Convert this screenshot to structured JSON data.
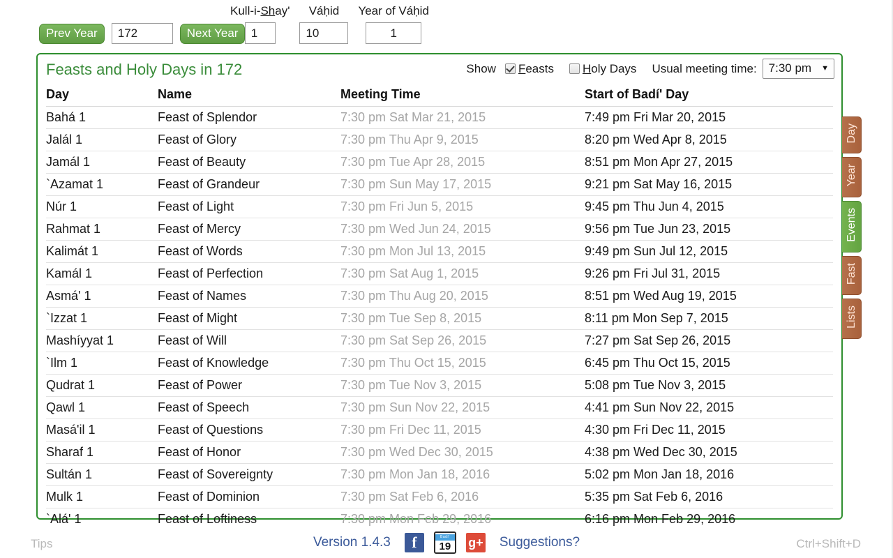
{
  "topbar": {
    "prev_year_label": "Prev Year",
    "next_year_label": "Next Year",
    "year_value": "172",
    "kullishay_label_prefix": "Kull-i-",
    "kullishay_label_underline": "Sh",
    "kullishay_label_suffix": "ay'",
    "kullishay_value": "1",
    "vahid_label": "Váḥid",
    "vahid_value": "10",
    "year_of_vahid_label": "Year of Váḥid",
    "year_of_vahid_value": "1"
  },
  "panel": {
    "title": "Feasts and Holy Days in 172",
    "show_label": "Show",
    "feasts_label_underline": "F",
    "feasts_label_rest": "easts",
    "feasts_checked": true,
    "holydays_label_underline": "H",
    "holydays_label_rest": "oly Days",
    "holydays_checked": false,
    "meeting_time_label": "Usual meeting time:",
    "meeting_time_value": "7:30 pm",
    "meeting_time_options": [
      "7:30 pm"
    ]
  },
  "table": {
    "columns": [
      "Day",
      "Name",
      "Meeting Time",
      "Start of Badí' Day"
    ],
    "rows": [
      {
        "day": "Bahá 1",
        "name": "Feast of Splendor",
        "meeting": "7:30 pm Sat Mar 21, 2015",
        "start": "7:49 pm Fri Mar 20, 2015"
      },
      {
        "day": "Jalál 1",
        "name": "Feast of Glory",
        "meeting": "7:30 pm Thu Apr 9, 2015",
        "start": "8:20 pm Wed Apr 8, 2015"
      },
      {
        "day": "Jamál 1",
        "name": "Feast of Beauty",
        "meeting": "7:30 pm Tue Apr 28, 2015",
        "start": "8:51 pm Mon Apr 27, 2015"
      },
      {
        "day": "`Azamat 1",
        "name": "Feast of Grandeur",
        "meeting": "7:30 pm Sun May 17, 2015",
        "start": "9:21 pm Sat May 16, 2015"
      },
      {
        "day": "Núr 1",
        "name": "Feast of Light",
        "meeting": "7:30 pm Fri Jun 5, 2015",
        "start": "9:45 pm Thu Jun 4, 2015"
      },
      {
        "day": "Rahmat 1",
        "name": "Feast of Mercy",
        "meeting": "7:30 pm Wed Jun 24, 2015",
        "start": "9:56 pm Tue Jun 23, 2015"
      },
      {
        "day": "Kalimát 1",
        "name": "Feast of Words",
        "meeting": "7:30 pm Mon Jul 13, 2015",
        "start": "9:49 pm Sun Jul 12, 2015"
      },
      {
        "day": "Kamál 1",
        "name": "Feast of Perfection",
        "meeting": "7:30 pm Sat Aug 1, 2015",
        "start": "9:26 pm Fri Jul 31, 2015"
      },
      {
        "day": "Asmá' 1",
        "name": "Feast of Names",
        "meeting": "7:30 pm Thu Aug 20, 2015",
        "start": "8:51 pm Wed Aug 19, 2015"
      },
      {
        "day": "`Izzat 1",
        "name": "Feast of Might",
        "meeting": "7:30 pm Tue Sep 8, 2015",
        "start": "8:11 pm Mon Sep 7, 2015"
      },
      {
        "day": "Mashíyyat 1",
        "name": "Feast of Will",
        "meeting": "7:30 pm Sat Sep 26, 2015",
        "start": "7:27 pm Sat Sep 26, 2015"
      },
      {
        "day": "`Ilm 1",
        "name": "Feast of Knowledge",
        "meeting": "7:30 pm Thu Oct 15, 2015",
        "start": "6:45 pm Thu Oct 15, 2015"
      },
      {
        "day": "Qudrat 1",
        "name": "Feast of Power",
        "meeting": "7:30 pm Tue Nov 3, 2015",
        "start": "5:08 pm Tue Nov 3, 2015"
      },
      {
        "day": "Qawl 1",
        "name": "Feast of Speech",
        "meeting": "7:30 pm Sun Nov 22, 2015",
        "start": "4:41 pm Sun Nov 22, 2015"
      },
      {
        "day": "Masá'il 1",
        "name": "Feast of Questions",
        "meeting": "7:30 pm Fri Dec 11, 2015",
        "start": "4:30 pm Fri Dec 11, 2015"
      },
      {
        "day": "Sharaf 1",
        "name": "Feast of Honor",
        "meeting": "7:30 pm Wed Dec 30, 2015",
        "start": "4:38 pm Wed Dec 30, 2015"
      },
      {
        "day": "Sultán 1",
        "name": "Feast of Sovereignty",
        "meeting": "7:30 pm Mon Jan 18, 2016",
        "start": "5:02 pm Mon Jan 18, 2016"
      },
      {
        "day": "Mulk 1",
        "name": "Feast of Dominion",
        "meeting": "7:30 pm Sat Feb 6, 2016",
        "start": "5:35 pm Sat Feb 6, 2016"
      },
      {
        "day": "`Alá' 1",
        "name": "Feast of Loftiness",
        "meeting": "7:30 pm Mon Feb 29, 2016",
        "start": "6:16 pm Mon Feb 29, 2016"
      }
    ]
  },
  "sidetabs": [
    {
      "label": "Day",
      "active": false
    },
    {
      "label": "Year",
      "active": false
    },
    {
      "label": "Events",
      "active": true
    },
    {
      "label": "Fast",
      "active": false
    },
    {
      "label": "Lists",
      "active": false
    }
  ],
  "footer": {
    "tips_label": "Tips",
    "version_label": "Version 1.4.3",
    "facebook_icon_label": "f",
    "calendar_icon_top": "Badí'",
    "calendar_icon_number": "19",
    "googleplus_icon_label": "g+",
    "suggestions_label": "Suggestions?",
    "shortcut_label": "Ctrl+Shift+D"
  },
  "colors": {
    "brand_green": "#2f8f2f",
    "title_green": "#3a8c3a",
    "button_green": "#6aa84f",
    "tab_brown": "#a9613c",
    "muted_grey": "#a6a6a6",
    "link_blue": "#3b5a9a"
  }
}
